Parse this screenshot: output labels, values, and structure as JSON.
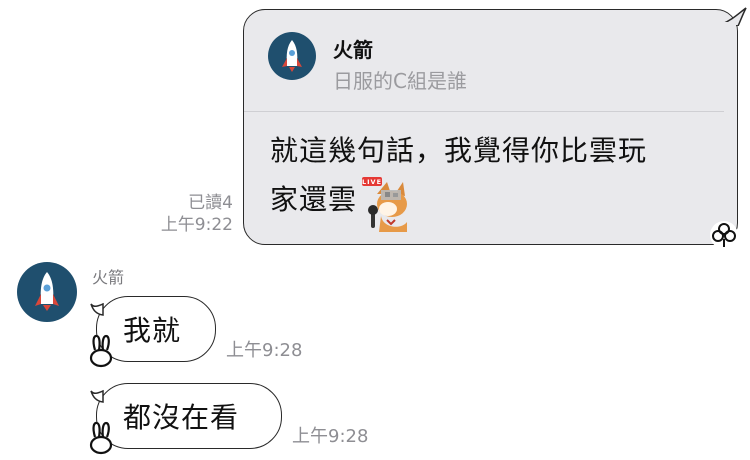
{
  "outgoing": {
    "reply_quote": {
      "sender_name": "火箭",
      "quoted_text": "日服的C組是誰"
    },
    "body_line1": "就這幾句話，我覺得你比雲玩",
    "body_line2": "家還雲",
    "sticker": {
      "icon": "fox-streamer-sticker-icon",
      "badge": "LIVE"
    },
    "read_status": "已讀4",
    "time": "上午9:22",
    "reaction_icon": "clover-reaction-icon"
  },
  "incoming": {
    "sender_name": "火箭",
    "avatar_icon": "rocket-avatar-icon",
    "messages": [
      {
        "text": "我就",
        "time": "上午9:28",
        "reaction_icon": "bunny-reaction-icon"
      },
      {
        "text": "都沒在看",
        "time": "上午9:28",
        "reaction_icon": "bunny-reaction-icon"
      }
    ]
  },
  "colors": {
    "outgoing_bubble": "#e9e9ec",
    "avatar_bg": "#1f4f6e",
    "rocket_red": "#d9473a",
    "meta_gray": "#8e8e93"
  }
}
